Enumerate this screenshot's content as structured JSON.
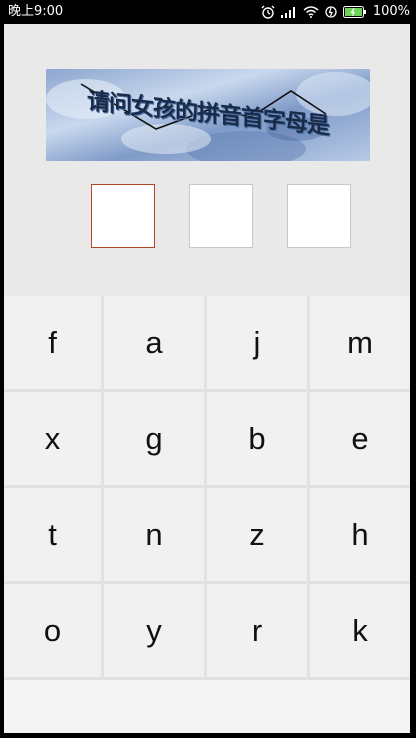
{
  "status_bar": {
    "time": "晚上9:00",
    "battery_percent": "100%",
    "icons": [
      "alarm-icon",
      "signal-icon",
      "wifi-icon",
      "data-sync-icon",
      "battery-icon"
    ]
  },
  "captcha": {
    "text": "请问女孩的拼音首字母是",
    "colors": {
      "background": "#a9bcdc",
      "text": "#1a2b49"
    }
  },
  "answer_boxes": [
    {
      "value": "",
      "active": true
    },
    {
      "value": "",
      "active": false
    },
    {
      "value": "",
      "active": false
    }
  ],
  "keypad": {
    "keys": [
      "f",
      "a",
      "j",
      "m",
      "x",
      "g",
      "b",
      "e",
      "t",
      "n",
      "z",
      "h",
      "o",
      "y",
      "r",
      "k"
    ]
  },
  "colors": {
    "active_box_border": "#b3472a",
    "top_panel": "#e9e9e9",
    "key_background": "#f1f1f1"
  }
}
